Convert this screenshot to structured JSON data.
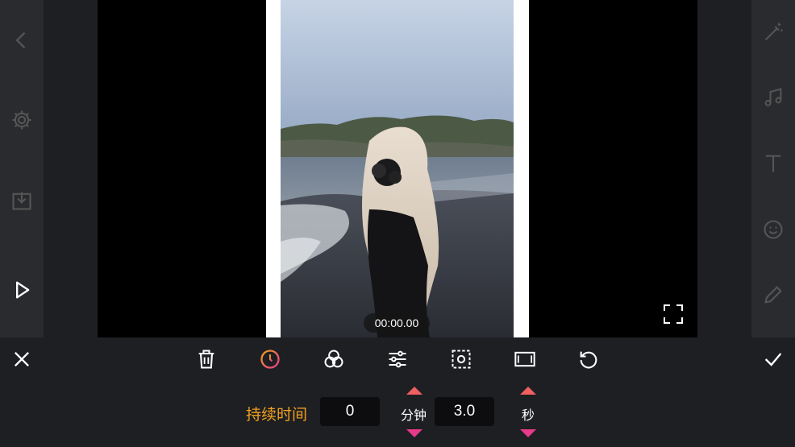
{
  "preview": {
    "timestamp": "00:00.00"
  },
  "left_rail": {
    "icons": [
      "back-icon",
      "gear-icon",
      "download-icon",
      "play-icon"
    ]
  },
  "right_rail": {
    "icons": [
      "magic-wand-icon",
      "music-icon",
      "text-icon",
      "emoji-icon",
      "pen-icon"
    ]
  },
  "toolbar": {
    "icons": [
      "close-icon",
      "trash-icon",
      "clock-icon",
      "filter-icon",
      "adjust-icon",
      "crop-focus-icon",
      "frame-icon",
      "rotate-icon",
      "check-icon"
    ],
    "active_color": "#e8a020"
  },
  "duration": {
    "label": "持续时间",
    "minutes_value": "0",
    "minutes_unit": "分钟",
    "seconds_value": "3.0",
    "seconds_unit": "秒"
  },
  "colors": {
    "accent": "#f0a020",
    "arrow_up": "#f06060",
    "arrow_down": "#e83a8a"
  }
}
